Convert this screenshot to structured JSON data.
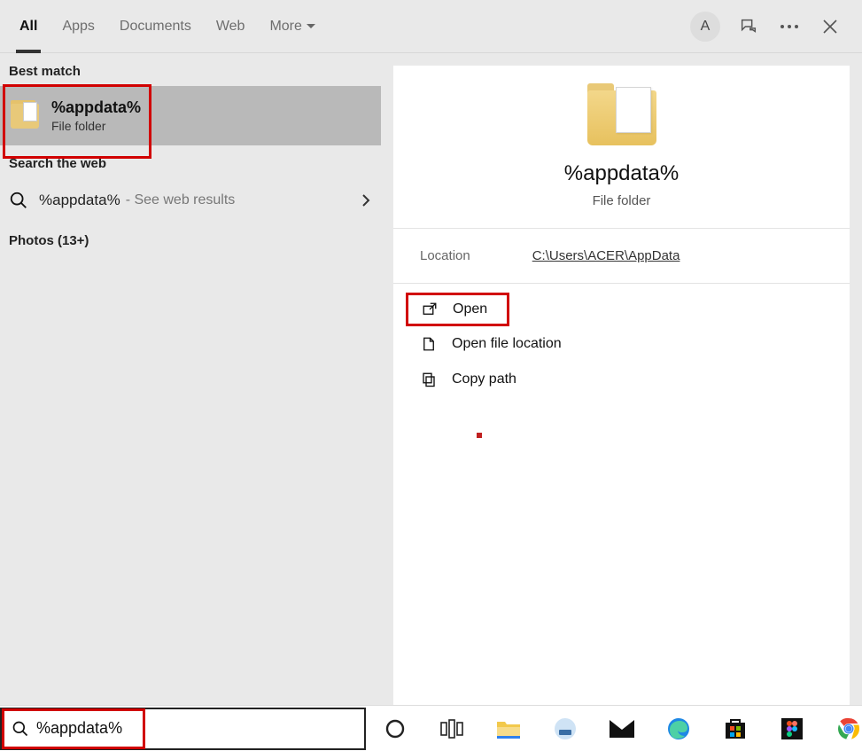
{
  "tabs": {
    "all": "All",
    "apps": "Apps",
    "documents": "Documents",
    "web": "Web",
    "more": "More"
  },
  "top": {
    "avatar_initial": "A"
  },
  "left": {
    "best_match_label": "Best match",
    "best_match": {
      "title": "%appdata%",
      "subtitle": "File folder"
    },
    "search_web_label": "Search the web",
    "web_result": {
      "query": "%appdata%",
      "hint": "- See web results"
    },
    "photos_label": "Photos (13+)"
  },
  "preview": {
    "title": "%appdata%",
    "subtitle": "File folder",
    "location_label": "Location",
    "location_value": "C:\\Users\\ACER\\AppData",
    "actions": {
      "open": "Open",
      "open_location": "Open file location",
      "copy_path": "Copy path"
    }
  },
  "search": {
    "value": "%appdata%"
  },
  "taskbar": {
    "items": [
      "cortana-icon",
      "task-view-icon",
      "file-explorer-icon",
      "app-icon",
      "mail-icon",
      "edge-icon",
      "microsoft-store-icon",
      "figma-icon",
      "chrome-icon"
    ]
  }
}
